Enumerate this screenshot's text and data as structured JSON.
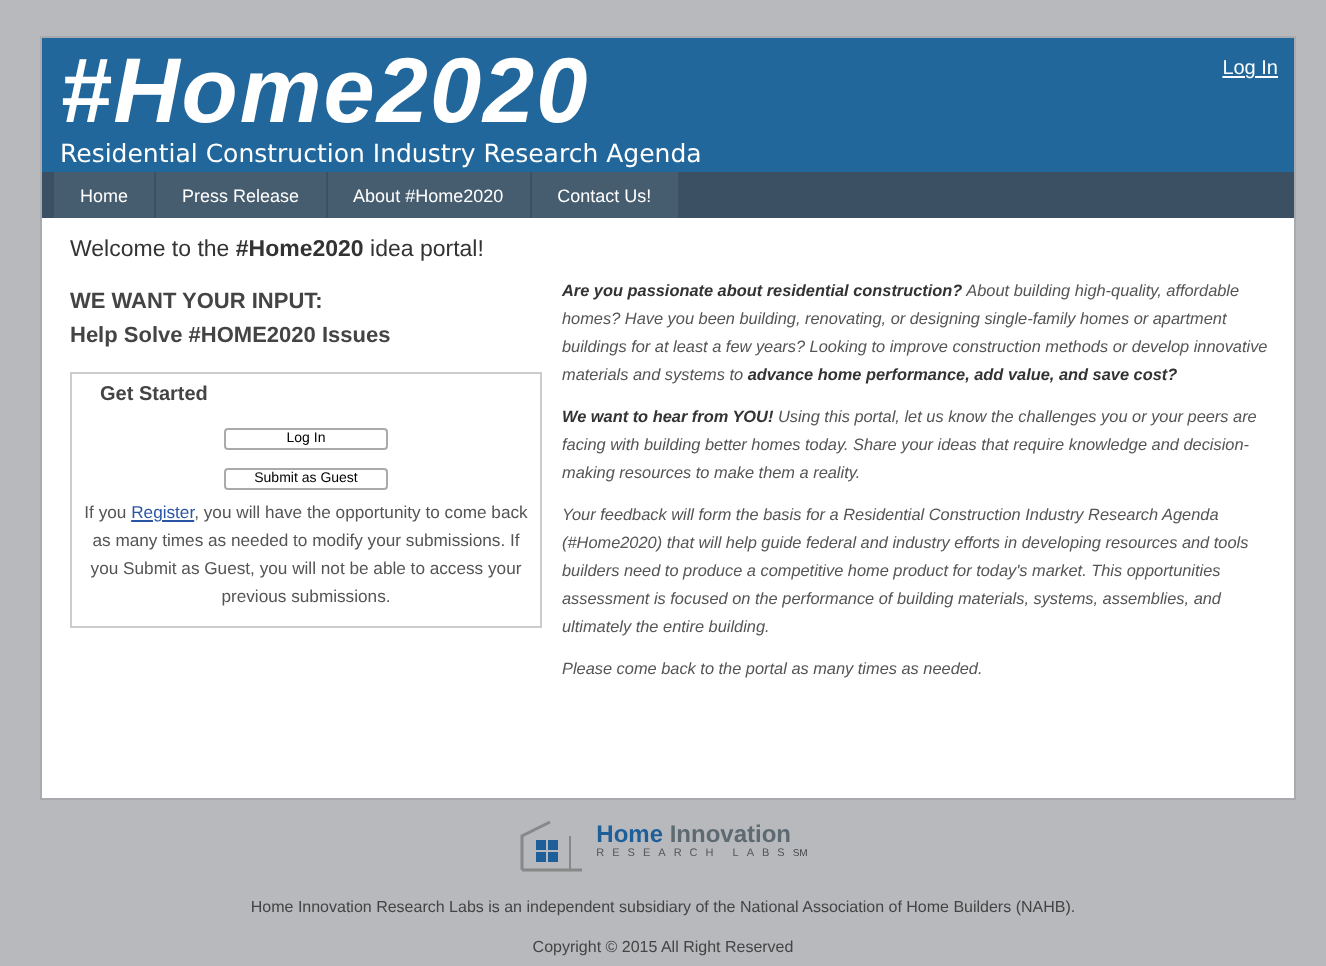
{
  "header": {
    "title": "#Home2020",
    "subtitle": "Residential Construction Industry Research Agenda",
    "login_link": "Log In"
  },
  "nav": [
    "Home",
    "Press Release",
    "About #Home2020",
    "Contact Us!"
  ],
  "welcome": "Welcome to the **#Home2020** idea portal!",
  "left": {
    "heading": "WE WANT YOUR INPUT:",
    "subheading": "Help Solve #HOME2020 Issues",
    "panel": {
      "legend": "Get Started",
      "buttons": [
        "Log In",
        "Submit as Guest"
      ],
      "note_before": "If you ",
      "note_link": "Register",
      "note_after": ", you will have the opportunity to come back as many times as needed to modify your submissions. If you Submit as Guest, you will not be able to access your previous submissions."
    }
  },
  "paragraphs": [
    "**Are you passionate about residential construction?** About building high-quality, affordable homes? Have you been building, renovating, or designing single-family homes or apartment buildings for at least a few years? Looking to improve construction methods or develop innovative materials and systems to **advance home performance, add value, and save cost?**",
    "**We want to hear from YOU!** Using this portal, let us know the challenges you or your peers are facing with building better homes today. Share your ideas that require knowledge and decision-making resources to make them a reality.",
    "Your feedback will form the basis for a Residential Construction Industry Research Agenda (#Home2020) that will help guide federal and industry efforts in developing resources and tools builders need to produce a competitive home product for today's market. This opportunities assessment is focused on the performance of building materials, systems, assemblies, and ultimately the entire building.",
    "Please come back to the portal as many times as needed."
  ],
  "footer": {
    "logo_name": "**Home** Innovation",
    "logo_tagline": "RESEARCH LABS",
    "logo_mark": "SM",
    "about": "Home Innovation Research Labs is an independent subsidiary of the National Association of Home Builders (NAHB).",
    "copyright": "Copyright © 2015 All Right Reserved"
  }
}
